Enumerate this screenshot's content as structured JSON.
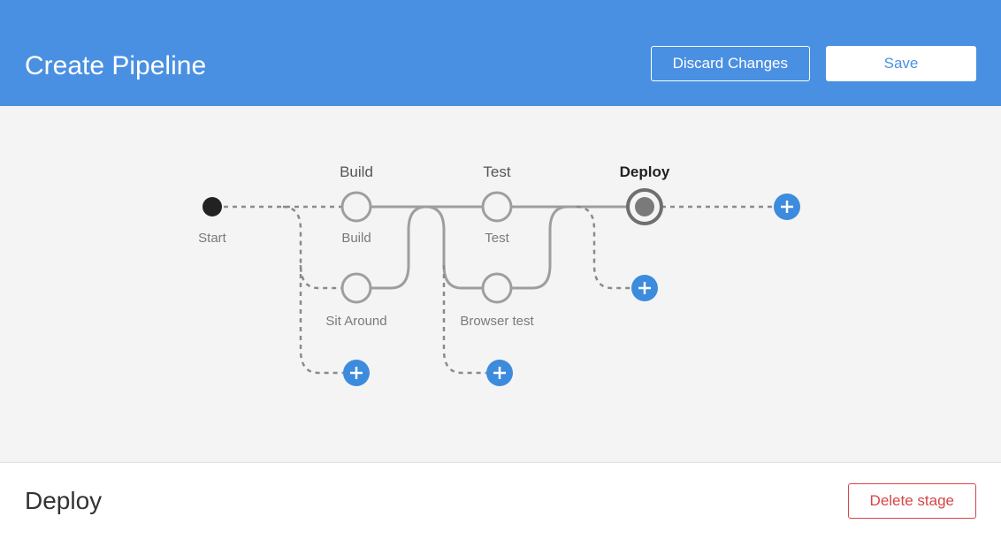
{
  "header": {
    "title": "Create Pipeline",
    "discard_label": "Discard Changes",
    "save_label": "Save"
  },
  "pipeline": {
    "start_label": "Start",
    "stages": [
      {
        "name": "Build",
        "nodes": [
          {
            "label": "Build"
          },
          {
            "label": "Sit Around"
          }
        ]
      },
      {
        "name": "Test",
        "nodes": [
          {
            "label": "Test"
          },
          {
            "label": "Browser test"
          }
        ]
      },
      {
        "name": "Deploy",
        "selected": true,
        "nodes": []
      }
    ]
  },
  "detail": {
    "selected_stage": "Deploy",
    "delete_label": "Delete stage"
  },
  "colors": {
    "primary": "#4a90e2",
    "danger": "#d64545",
    "canvas_bg": "#f4f4f4"
  }
}
